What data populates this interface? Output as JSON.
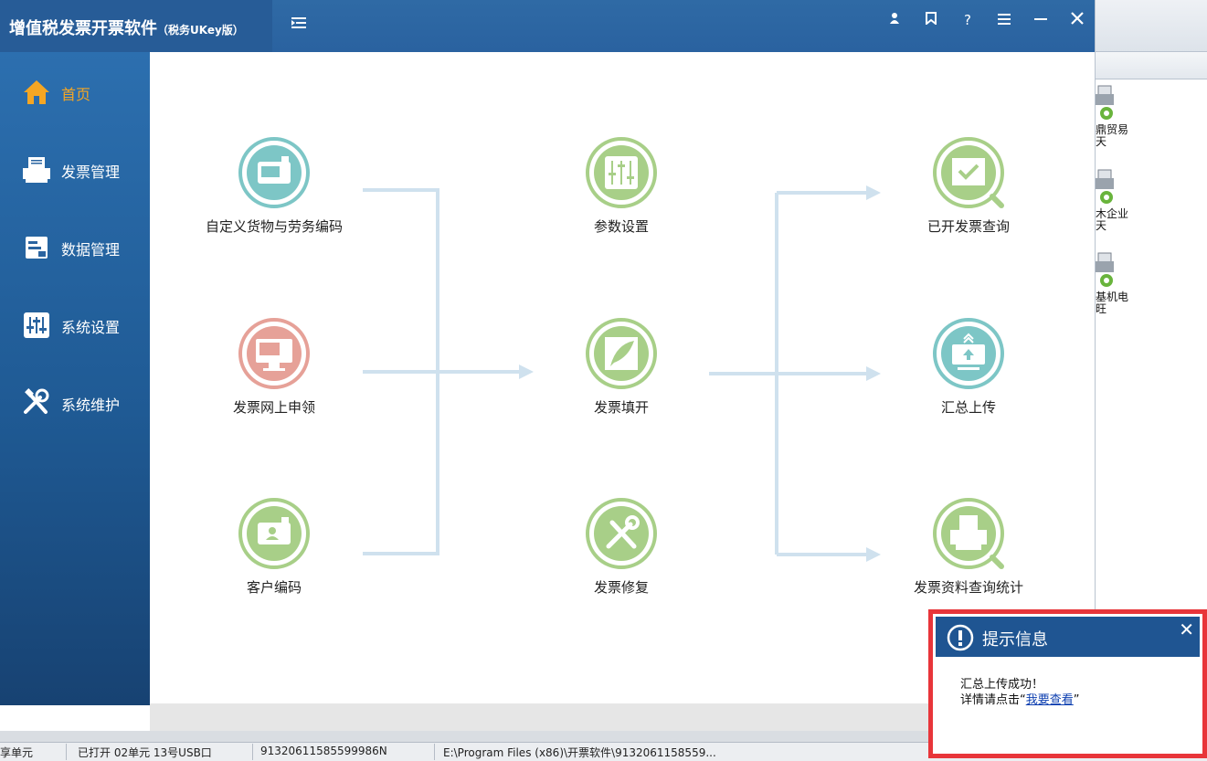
{
  "window": {
    "title": "增值税发票开票软件",
    "title_suffix": "（税务UKey版）"
  },
  "titlebar_buttons": [
    "user-icon",
    "bookmark-icon",
    "help-icon",
    "menu-icon",
    "minimize-icon",
    "close-icon"
  ],
  "sidebar": {
    "items": [
      {
        "label": "首页",
        "icon": "home-icon",
        "active": true
      },
      {
        "label": "发票管理",
        "icon": "printer-icon",
        "active": false
      },
      {
        "label": "数据管理",
        "icon": "database-icon",
        "active": false
      },
      {
        "label": "系统设置",
        "icon": "sliders-icon",
        "active": false
      },
      {
        "label": "系统维护",
        "icon": "tools-icon",
        "active": false
      }
    ]
  },
  "flow": {
    "left": [
      {
        "label": "自定义货物与劳务编码",
        "icon": "cart-wallet-icon",
        "color": "#7dc6c6"
      },
      {
        "label": "发票网上申领",
        "icon": "monitor-apply-icon",
        "color": "#e6a198"
      },
      {
        "label": "客户编码",
        "icon": "contact-card-icon",
        "color": "#a8cf88"
      }
    ],
    "center": [
      {
        "label": "参数设置",
        "icon": "sliders-icon",
        "color": "#a8cf88"
      },
      {
        "label": "发票填开",
        "icon": "quill-icon",
        "color": "#a8cf88"
      },
      {
        "label": "发票修复",
        "icon": "tools-icon",
        "color": "#a8cf88"
      }
    ],
    "right": [
      {
        "label": "已开发票查询",
        "icon": "check-search-icon",
        "color": "#a8cf88"
      },
      {
        "label": "汇总上传",
        "icon": "upload-monitor-icon",
        "color": "#7dc6c6"
      },
      {
        "label": "发票资料查询统计",
        "icon": "printer-search-icon",
        "color": "#a8cf88"
      }
    ]
  },
  "background_app": {
    "items": [
      {
        "line1": "鼎贸易",
        "line2": "天"
      },
      {
        "line1": "木企业",
        "line2": "天"
      },
      {
        "line1": "基机电",
        "line2": "旺"
      }
    ]
  },
  "status_bar": {
    "seg1": "享单元",
    "seg2": "已打开 02单元 13号USB口",
    "seg3": "91320611585599986N",
    "seg4": "E:\\Program Files (x86)\\开票软件\\9132061158559..."
  },
  "popup": {
    "title": "提示信息",
    "message": "汇总上传成功！",
    "detail_prefix": "详情请点击“",
    "link_text": "我要查看",
    "detail_suffix": "”"
  }
}
